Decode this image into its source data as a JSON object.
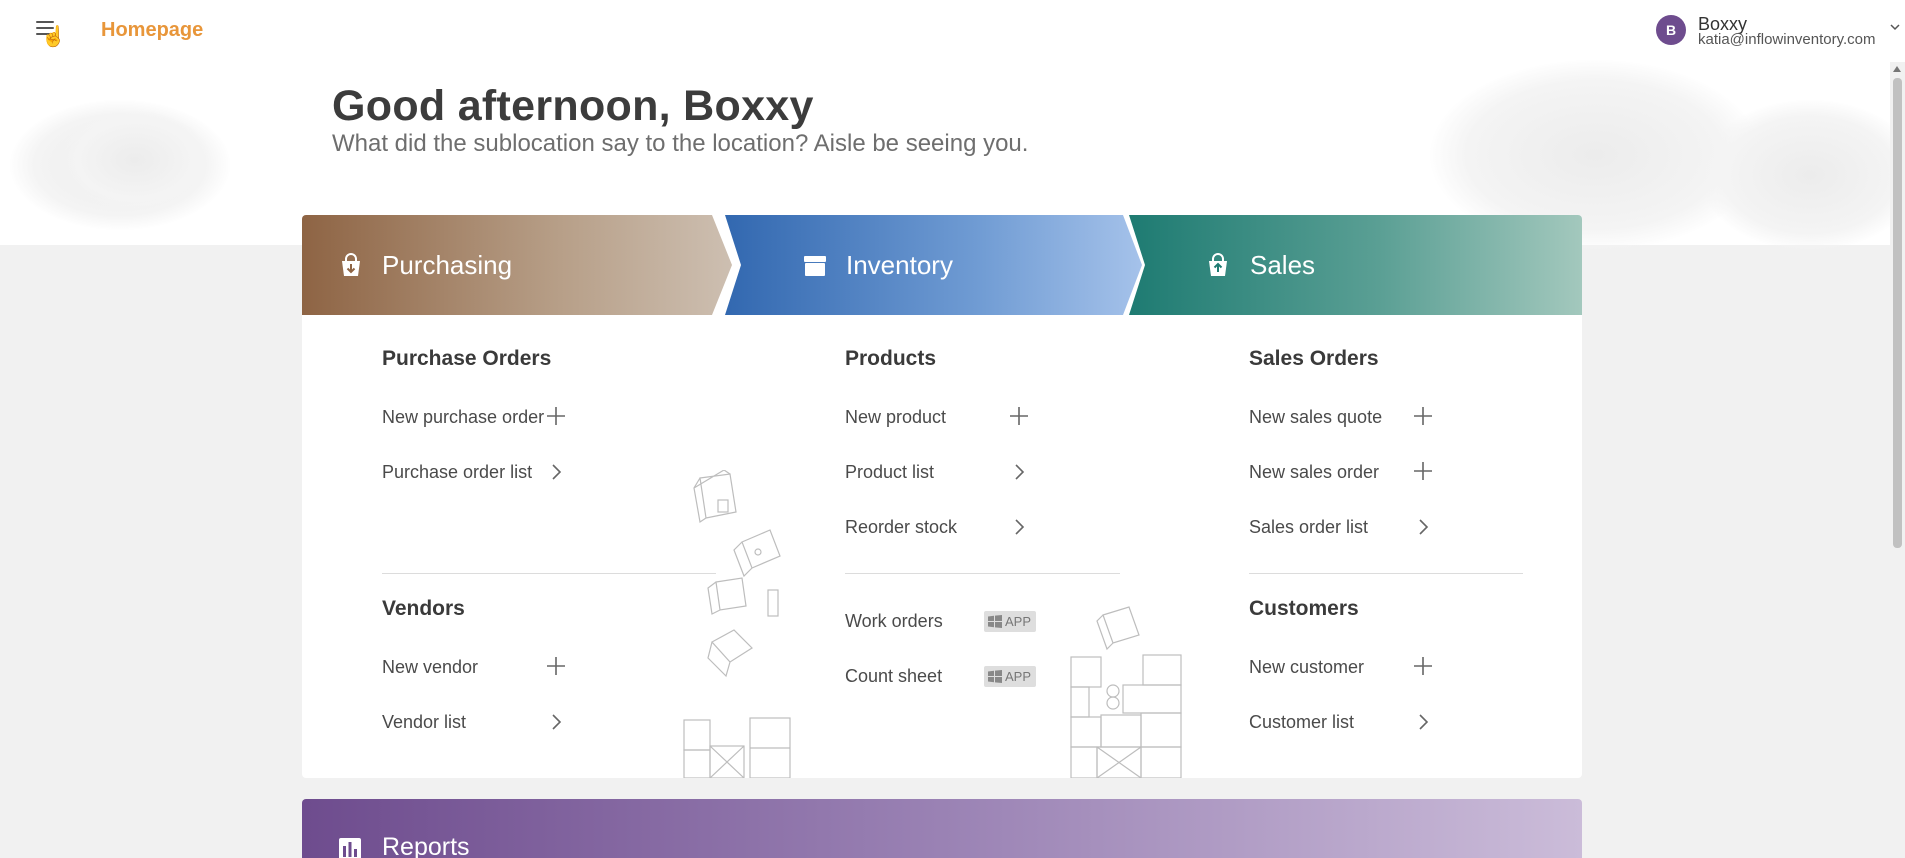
{
  "header": {
    "title": "Homepage",
    "user_name": "Boxxy",
    "user_email": "katia@inflowinventory.com",
    "avatar_letter": "B"
  },
  "greeting": {
    "title": "Good afternoon, Boxxy",
    "subtitle": "What did the sublocation say to the location? Aisle be seeing you."
  },
  "purchasing": {
    "band_label": "Purchasing",
    "orders_title": "Purchase Orders",
    "new_order": "New purchase order",
    "order_list": "Purchase order list",
    "vendors_title": "Vendors",
    "new_vendor": "New vendor",
    "vendor_list": "Vendor list"
  },
  "inventory": {
    "band_label": "Inventory",
    "products_title": "Products",
    "new_product": "New product",
    "product_list": "Product list",
    "reorder_stock": "Reorder stock",
    "work_orders": "Work orders",
    "count_sheet": "Count sheet",
    "app_badge": "APP"
  },
  "sales": {
    "band_label": "Sales",
    "orders_title": "Sales Orders",
    "new_quote": "New sales quote",
    "new_order": "New sales order",
    "order_list": "Sales order list",
    "customers_title": "Customers",
    "new_customer": "New customer",
    "customer_list": "Customer list"
  },
  "reports": {
    "band_label": "Reports"
  },
  "icons": {
    "menu": "hamburger-icon",
    "cursor": "hand-pointer-icon",
    "purchasing": "shopping-bag-down-icon",
    "inventory": "box-icon",
    "sales": "shopping-bag-up-icon",
    "add": "plus-icon",
    "go": "chevron-right-icon",
    "windows": "windows-icon",
    "reports": "bar-chart-icon"
  },
  "colors": {
    "accent": "#e8963a",
    "purchasing": "#8e6444",
    "inventory": "#3268b0",
    "sales": "#1e7b72",
    "reports": "#6e4c8e"
  }
}
